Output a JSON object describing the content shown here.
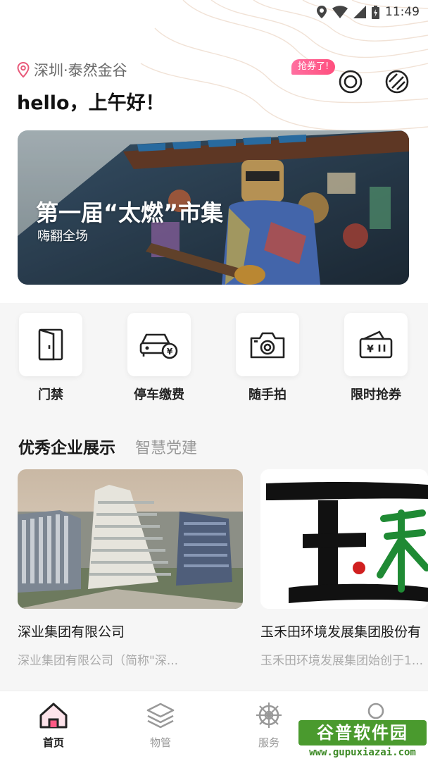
{
  "status_bar": {
    "time": "11:49"
  },
  "header": {
    "location": "深圳·泰然金谷",
    "greeting": "hello，上午好！",
    "coupon_badge": "抢券了!",
    "icons": [
      "target-icon",
      "slash-circle-icon"
    ]
  },
  "banner": {
    "title": "第一届“太燃”市集",
    "subtitle": "嗨翻全场"
  },
  "services": [
    {
      "label": "门禁",
      "icon": "door-icon"
    },
    {
      "label": "停车缴费",
      "icon": "car-yen-icon"
    },
    {
      "label": "随手拍",
      "icon": "camera-icon"
    },
    {
      "label": "限时抢券",
      "icon": "ticket-yen-icon"
    }
  ],
  "section": {
    "tabs": [
      "优秀企业展示",
      "智慧党建"
    ],
    "active_tab": 0
  },
  "companies": [
    {
      "name": "深业集团有限公司",
      "desc": "深业集团有限公司（简称\"深..."
    },
    {
      "name": "玉禾田环境发展集团股份有",
      "desc": "玉禾田环境发展集团始创于1..."
    }
  ],
  "tabbar": {
    "items": [
      {
        "label": "首页",
        "icon": "home-icon",
        "active": true
      },
      {
        "label": "物管",
        "icon": "layers-icon",
        "active": false
      },
      {
        "label": "服务",
        "icon": "wheel-icon",
        "active": false
      },
      {
        "label": "",
        "icon": "profile-icon",
        "active": false
      }
    ]
  },
  "watermark": {
    "brand": "谷普软件园",
    "url": "www.gupuxiazai.com"
  },
  "colors": {
    "accent_pink": "#ff4f7e",
    "location_pink": "#e85a7a",
    "brand_green": "#4a9a2e"
  }
}
